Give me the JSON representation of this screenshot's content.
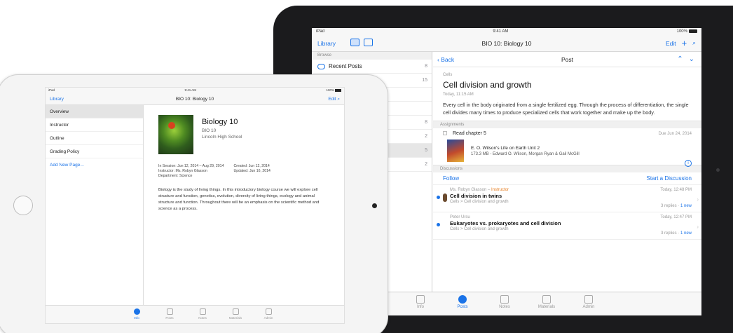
{
  "back": {
    "status": {
      "carrier": "iPad",
      "time": "9:41 AM",
      "battery": "100%"
    },
    "nav": {
      "library": "Library",
      "title": "BIO 10: Biology 10",
      "edit": "Edit"
    },
    "browse_header": "Browse",
    "sidebar": [
      {
        "label": "Recent Posts",
        "count": "8"
      },
      {
        "label": "",
        "count": "15"
      },
      {
        "label": "",
        "count": ""
      },
      {
        "label": "",
        "count": ""
      },
      {
        "label": "",
        "count": "8"
      },
      {
        "label": "",
        "count": "2"
      },
      {
        "label": "",
        "count": "5"
      },
      {
        "label": "",
        "count": "2"
      }
    ],
    "post_bar": {
      "back": "Back",
      "title": "Post"
    },
    "post": {
      "category": "Cells",
      "title": "Cell division and growth",
      "date": "Today, 11:15 AM",
      "body": "Every cell in the body originated from a single fertilized egg. Through the process of differentiation, the single cell divides many times to produce specialized cells that work together and make up the body."
    },
    "assignments_header": "Assignments",
    "assignment": {
      "title": "Read chapter 5",
      "due": "Due Jun 24, 2014",
      "attachment_title": "E. O. Wilson's Life on Earth Unit 2",
      "attachment_meta": "173.3 MB - Edward O. Wilson, Morgan Ryan & Gail McGill"
    },
    "discussions_header": "Discussions",
    "follow": "Follow",
    "start_discussion": "Start a Discussion",
    "discussions": [
      {
        "author": "Ms. Robyn Glasson",
        "role": "Instructor",
        "title": "Cell division in twins",
        "sub": "Cells > Cell division and growth",
        "time": "Today, 12:48 PM",
        "replies": "3 replies",
        "new": "1 new"
      },
      {
        "author": "Peter Ursu",
        "role": "",
        "title": "Eukaryotes vs. prokaryotes and cell division",
        "sub": "Cells > Cell division and growth",
        "time": "Today, 12:47 PM",
        "replies": "3 replies",
        "new": "1 new"
      }
    ],
    "tabs": [
      "Info",
      "Posts",
      "Notes",
      "Materials",
      "Admin"
    ]
  },
  "front": {
    "status": {
      "carrier": "iPad",
      "time": "9:41 AM",
      "battery": "100%"
    },
    "nav": {
      "library": "Library",
      "title": "BIO 10: Biology 10",
      "edit": "Edit"
    },
    "sidebar": [
      "Overview",
      "Instructor",
      "Outline",
      "Grading Policy"
    ],
    "add_page": "Add New Page...",
    "course": {
      "title": "Biology 10",
      "code": "BIO 10",
      "school": "Lincoln High School"
    },
    "meta_left": [
      "In Session: Jun 12, 2014 – Aug 29, 2014",
      "Instructor: Ms. Robyn Glasson",
      "Department: Science"
    ],
    "meta_right": [
      "Created: Jun 12, 2014",
      "Updated: Jun 16, 2014"
    ],
    "description": "Biology is the study of living things. In this introductory biology course we will explore cell structure and function, genetics, evolution, diversity of living things, ecology and animal structure and function. Throughout there will be an emphasis on the scientific method and science as a process.",
    "tabs": [
      "Info",
      "Posts",
      "Notes",
      "Materials",
      "Admin"
    ]
  },
  "colors": {
    "accent": "#1a73e8",
    "instructor": "#e67e22"
  }
}
